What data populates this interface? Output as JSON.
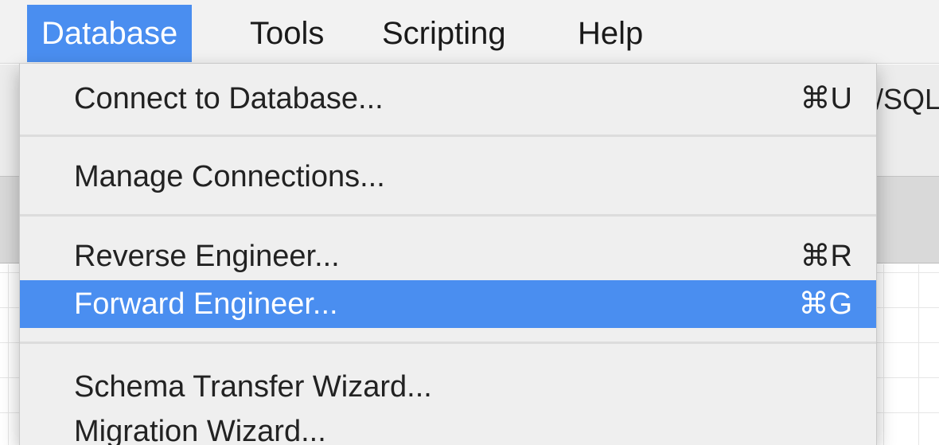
{
  "menubar": {
    "items": [
      {
        "label": "Database"
      },
      {
        "label": "Tools"
      },
      {
        "label": "Scripting"
      },
      {
        "label": "Help"
      }
    ]
  },
  "background": {
    "title_fragment": "/SQL"
  },
  "dropdown": {
    "items": [
      {
        "label": "Connect to Database...",
        "shortcut": "⌘U"
      },
      {
        "label": "Manage Connections...",
        "shortcut": ""
      },
      {
        "label": "Reverse Engineer...",
        "shortcut": "⌘R"
      },
      {
        "label": "Forward Engineer...",
        "shortcut": "⌘G"
      },
      {
        "label": "Schema Transfer Wizard...",
        "shortcut": ""
      },
      {
        "label": "Migration Wizard...",
        "shortcut": ""
      }
    ],
    "highlighted_index": 3
  },
  "colors": {
    "accent": "#4a8ef0",
    "menu_bg": "#efefef"
  }
}
